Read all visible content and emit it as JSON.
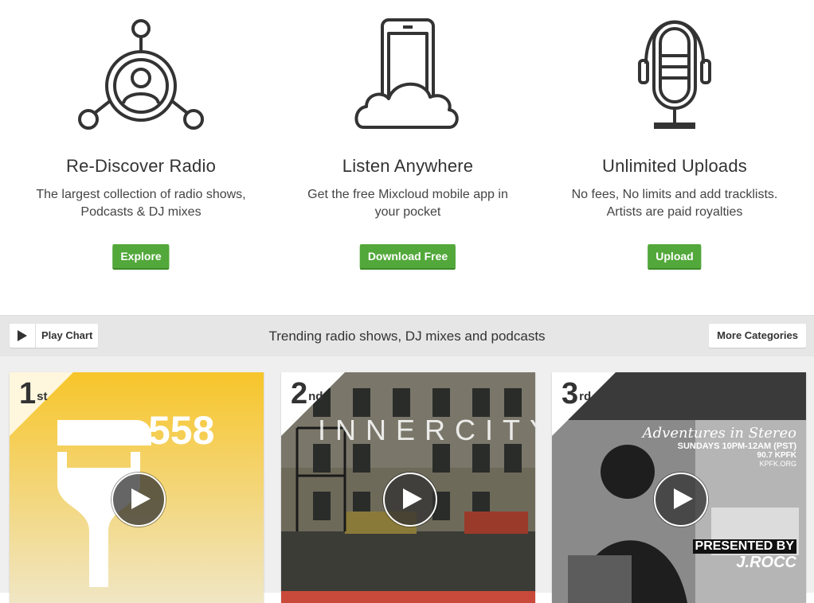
{
  "features": [
    {
      "title": "Re-Discover Radio",
      "desc_line1": "The largest collection of radio shows,",
      "desc_line2": "Podcasts & DJ mixes",
      "button": "Explore",
      "icon": "radio-network-icon"
    },
    {
      "title": "Listen Anywhere",
      "desc_line1": "Get the free Mixcloud mobile app in",
      "desc_line2": "your pocket",
      "button": "Download Free",
      "icon": "phone-cloud-icon"
    },
    {
      "title": "Unlimited Uploads",
      "desc_line1": "No fees, No limits and add tracklists.",
      "desc_line2": "Artists are paid royalties",
      "button": "Upload",
      "icon": "microphone-icon"
    }
  ],
  "chart_bar": {
    "play_label": "Play Chart",
    "title": "Trending radio shows, DJ mixes and podcasts",
    "more_label": "More Categories"
  },
  "cards": [
    {
      "rank": "1",
      "suffix": "st",
      "art_text": "558"
    },
    {
      "rank": "2",
      "suffix": "nd",
      "art_text": "INNERCITY"
    },
    {
      "rank": "3",
      "suffix": "rd",
      "art_line1": "Adventures in Stereo",
      "art_line2": "SUNDAYS 10PM-12AM (PST)",
      "art_line3": "90.7 KPFK",
      "art_line4": "KPFK.ORG",
      "art_line5": "PRESENTED BY",
      "art_line6": "J.ROCC"
    }
  ],
  "colors": {
    "accent_green": "#52a83a",
    "bar_bg": "#e6e6e6",
    "icon_stroke": "#333333"
  }
}
